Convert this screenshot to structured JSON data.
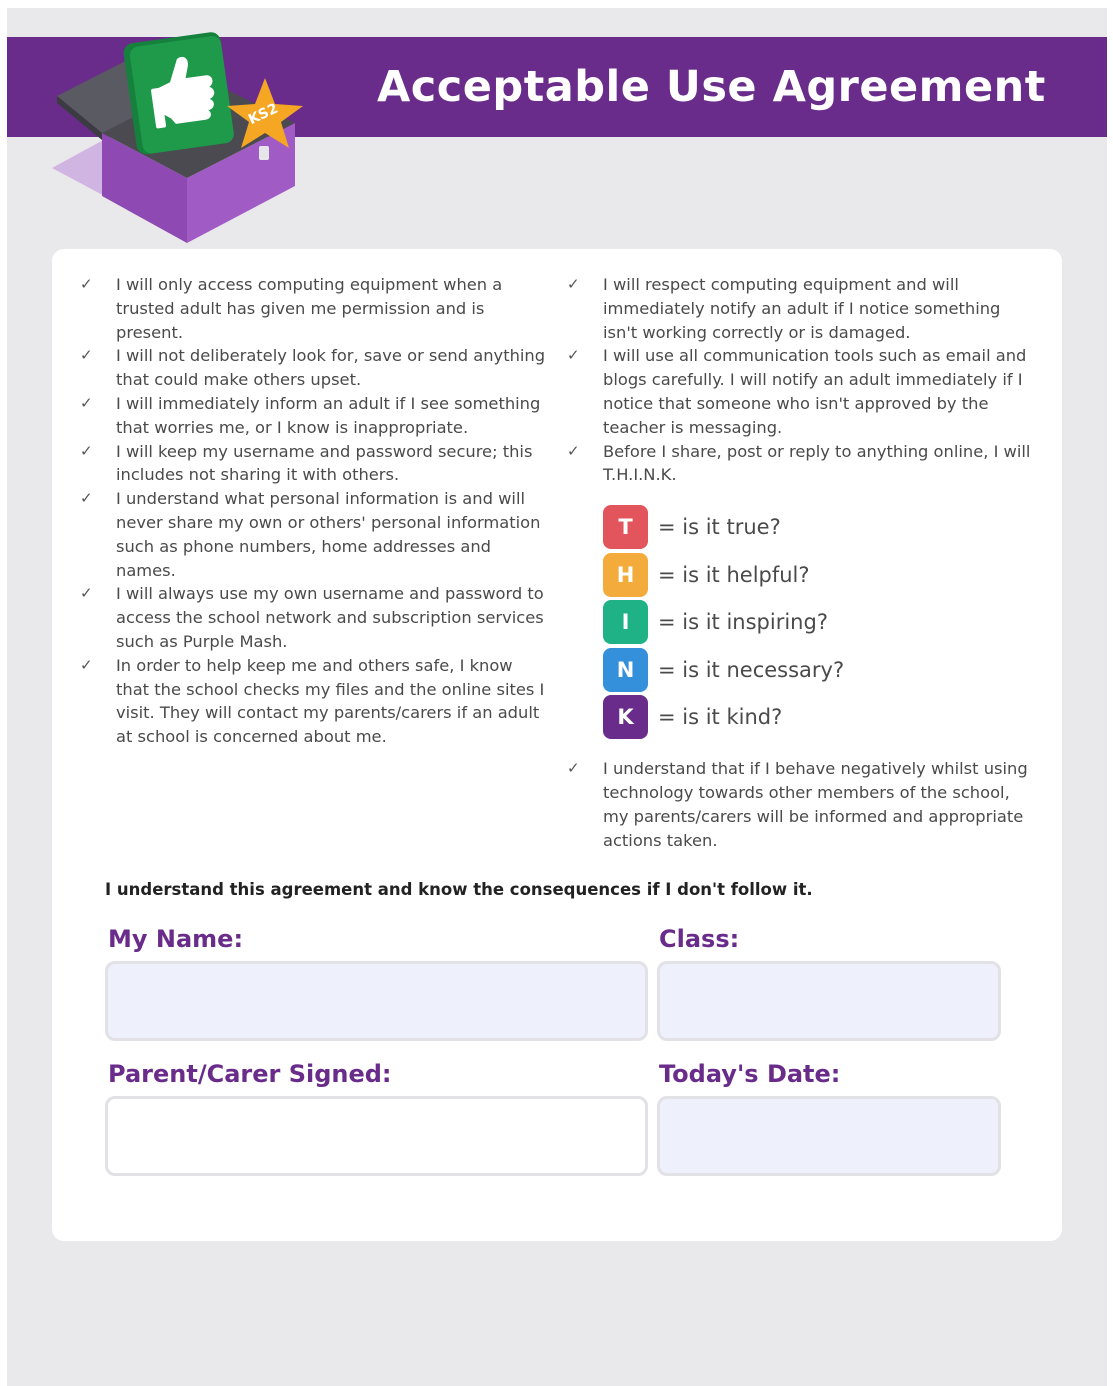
{
  "header": {
    "title": "Acceptable Use Agreement",
    "badge": "KS2",
    "colors": {
      "banner": "#6a2c8a",
      "accent_star": "#f5a623",
      "thumb_card": "#1f9a4b"
    }
  },
  "rules_left": [
    "I will only access computing equipment when a trusted adult has given me permission and is present.",
    "I will not deliberately look for, save or send anything that could make others upset.",
    "I will immediately inform an adult if I see something that worries me, or I know is inappropriate.",
    "I will keep my username and password secure; this includes not sharing it with others.",
    "I understand what personal information is and will never share my own or others' personal information such as phone numbers, home addresses and names.",
    "I will always use my own username and password to access the school network and subscription services such as Purple Mash.",
    "In order to help keep me and others safe, I know that the school checks my files and the online sites I visit. They will contact my parents/carers if an adult at school is concerned about me."
  ],
  "rules_right": [
    "I will respect computing equipment and will immediately notify an adult if I notice something isn't working correctly or is damaged.",
    "I will use all communication tools such as email and blogs carefully. I will notify an adult immediately if I notice that someone who isn't approved by the teacher is messaging.",
    "Before I share, post or reply to anything online, I will T.H.I.N.K."
  ],
  "think": [
    {
      "letter": "T",
      "text": "= is it true?",
      "color": "#e2555c"
    },
    {
      "letter": "H",
      "text": "= is it helpful?",
      "color": "#f3ac3c"
    },
    {
      "letter": "I",
      "text": "= is it inspiring?",
      "color": "#1fb287"
    },
    {
      "letter": "N",
      "text": "= is it necessary?",
      "color": "#3590dc"
    },
    {
      "letter": "K",
      "text": "= is it kind?",
      "color": "#6a2c8a"
    }
  ],
  "rule_after_think": "I understand that if I behave negatively whilst using technology towards other members of the school, my parents/carers will be informed and appropriate actions taken.",
  "check_mark": "✓",
  "agreement_statement": "I understand this agreement and know the consequences if I don't follow it.",
  "fields": {
    "name": {
      "label": "My Name:",
      "value": ""
    },
    "class": {
      "label": "Class:",
      "value": ""
    },
    "parent_signed": {
      "label": "Parent/Carer Signed:",
      "value": ""
    },
    "date": {
      "label": "Today's Date:",
      "value": ""
    }
  }
}
